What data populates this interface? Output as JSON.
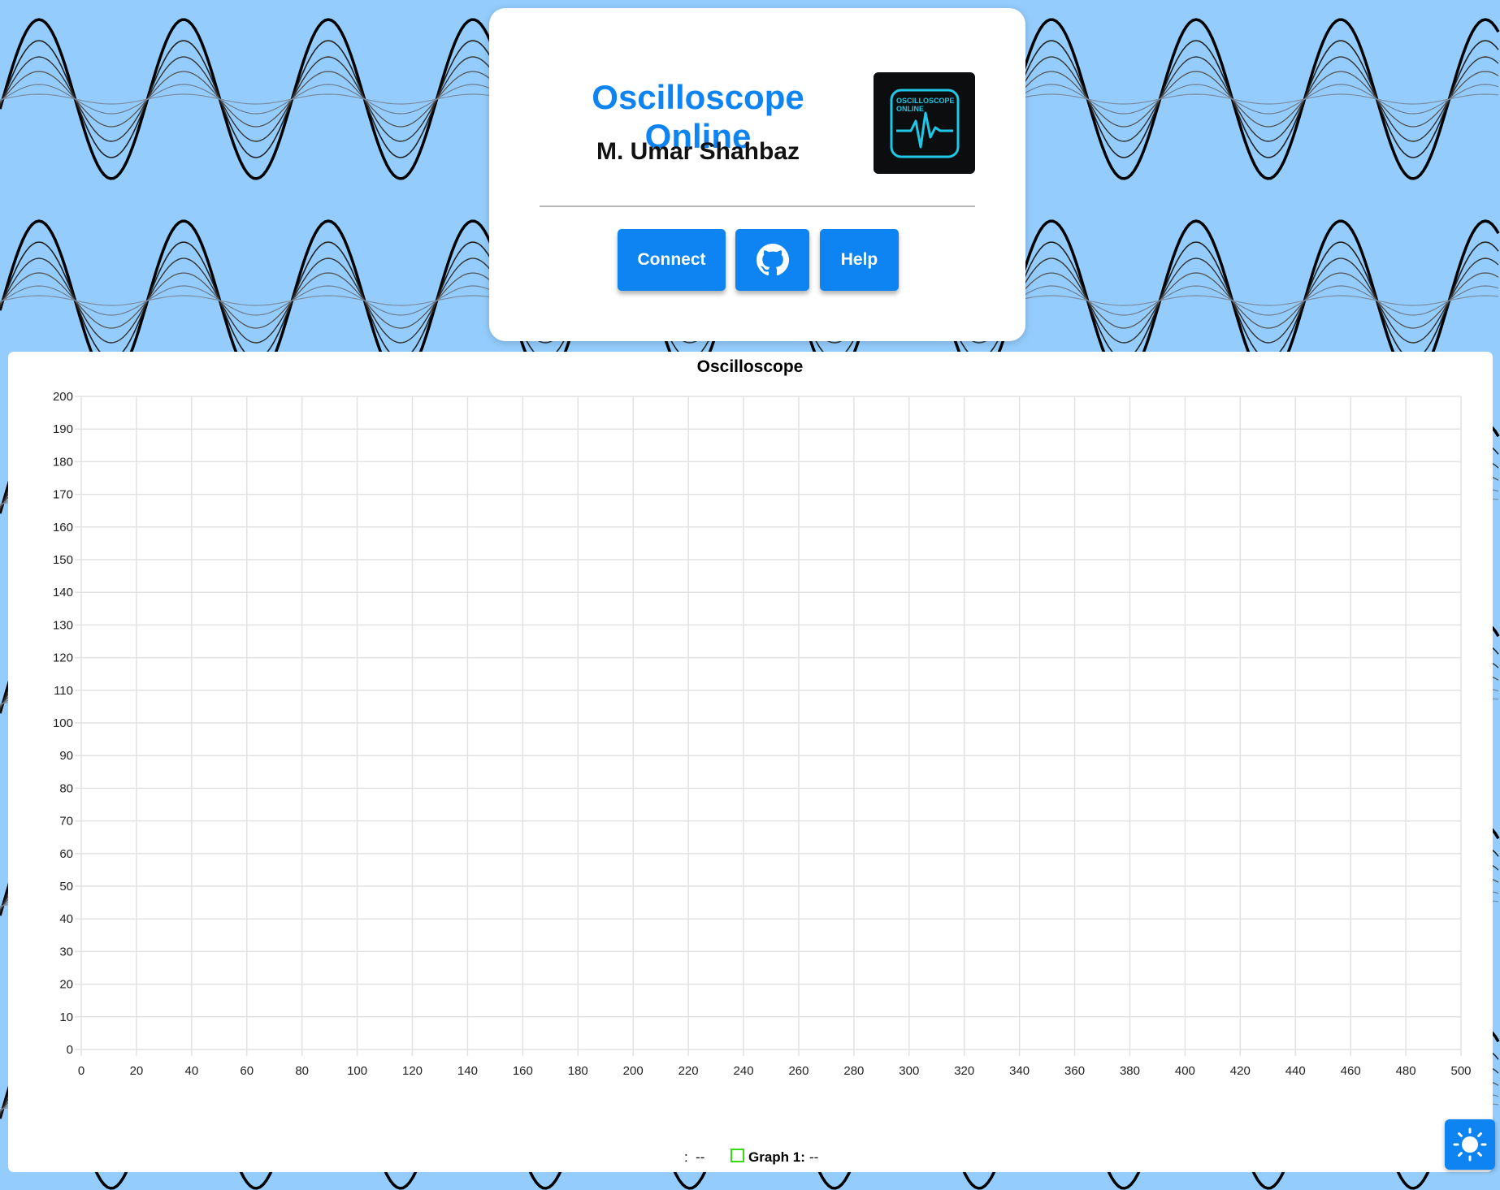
{
  "header": {
    "title": "Oscilloscope Online",
    "author": "M. Umar Shahbaz",
    "logo_text_line1": "OSCILLOSCOPE",
    "logo_text_line2": "ONLINE"
  },
  "buttons": {
    "connect_label": "Connect",
    "github_icon": "github-icon",
    "help_label": "Help"
  },
  "theme_toggle": {
    "icon": "sun-icon"
  },
  "colors": {
    "background": "#94cdfd",
    "accent": "#0d84f2",
    "logo_trace": "#1ec8e6",
    "graph1": "#33dd11"
  },
  "chart_data": {
    "type": "line",
    "title": "Oscilloscope",
    "xlabel": "",
    "ylabel": "",
    "xlim": [
      0,
      500
    ],
    "ylim": [
      0,
      200
    ],
    "x_ticks": [
      "0",
      "20",
      "40",
      "60",
      "80",
      "100",
      "120",
      "140",
      "160",
      "180",
      "200",
      "220",
      "240",
      "260",
      "280",
      "300",
      "320",
      "340",
      "360",
      "380",
      "400",
      "420",
      "440",
      "460",
      "480",
      "500"
    ],
    "y_ticks": [
      "0",
      "10",
      "20",
      "30",
      "40",
      "50",
      "60",
      "70",
      "80",
      "90",
      "100",
      "110",
      "120",
      "130",
      "140",
      "150",
      "160",
      "170",
      "180",
      "190",
      "200"
    ],
    "grid": true,
    "legend_position": "bottom",
    "legend": [
      {
        "label": ":",
        "value": "--"
      },
      {
        "label": "Graph 1:",
        "value": "--"
      }
    ],
    "series": []
  }
}
